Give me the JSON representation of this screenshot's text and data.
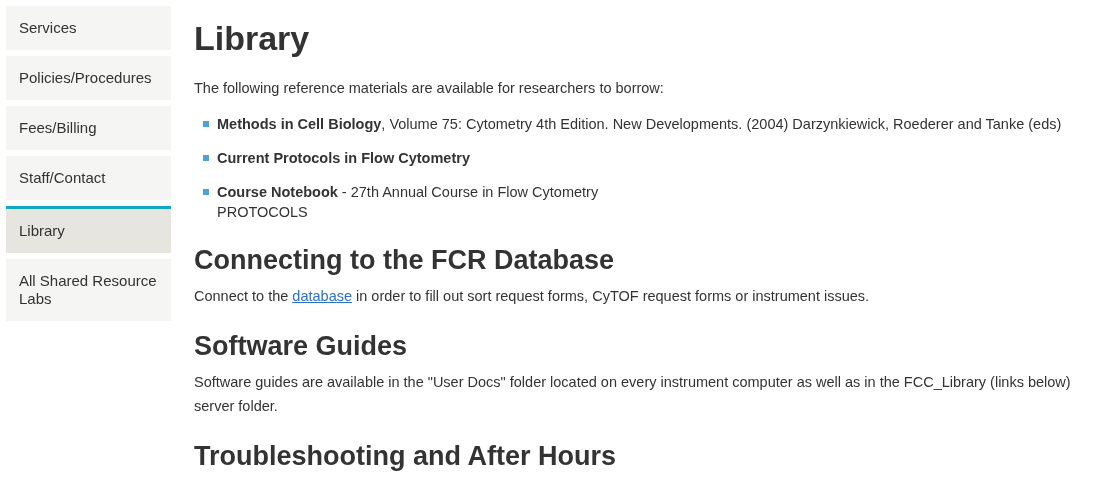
{
  "sidebar": {
    "items": [
      {
        "label": "Services",
        "selected": false
      },
      {
        "label": "Policies/Procedures",
        "selected": false
      },
      {
        "label": "Fees/Billing",
        "selected": false
      },
      {
        "label": "Staff/Contact",
        "selected": false
      },
      {
        "label": "Library",
        "selected": true
      },
      {
        "label": "All Shared Resource Labs",
        "selected": false
      }
    ]
  },
  "page_title": "Library",
  "intro": "The following reference materials are available for researchers to borrow:",
  "references": [
    {
      "text": "**Methods in Cell Biology**, Volume 75: Cytometry 4th Edition. New Developments. (2004) Darzynkiewick, Roederer and Tanke (eds)"
    },
    {
      "text": "**Current Protocols in Flow Cytometry**"
    },
    {
      "text": "**Course Notebook** - 27th Annual Course in Flow Cytometry",
      "note": "PROTOCOLS"
    }
  ],
  "sections": [
    {
      "heading": "Connecting to the FCR Database",
      "before": "Connect to the ",
      "link": "database",
      "after": " in order to fill out sort request forms, CyTOF request forms or instrument issues."
    },
    {
      "heading": "Software Guides",
      "text": "Software guides are available in the \"User Docs\" folder located on every instrument computer as well as in the FCC_Library (links below) server folder."
    },
    {
      "heading": "Troubleshooting and After Hours"
    }
  ]
}
